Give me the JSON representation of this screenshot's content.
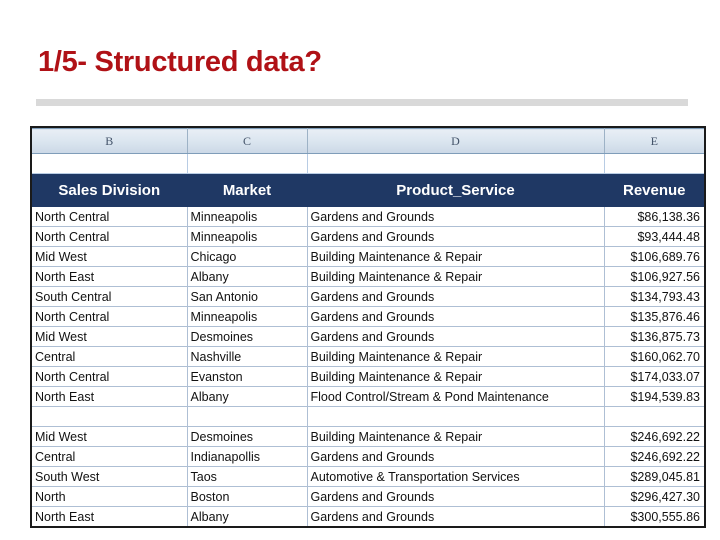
{
  "slide": {
    "title": "1/5- Structured data?",
    "title_color": "#B01116",
    "divider_color": "#D9D9D9"
  },
  "spreadsheet": {
    "header_bg": "#1F3864",
    "header_text_color": "#FFFFFF",
    "column_letters": [
      "B",
      "C",
      "D",
      "E"
    ],
    "columns": [
      "Sales Division",
      "Market",
      "Product_Service",
      "Revenue"
    ],
    "rows": [
      {
        "division": "North Central",
        "market": "Minneapolis",
        "product": "Gardens and Grounds",
        "revenue": "$86,138.36"
      },
      {
        "division": "North Central",
        "market": "Minneapolis",
        "product": "Gardens and Grounds",
        "revenue": "$93,444.48"
      },
      {
        "division": "Mid West",
        "market": "Chicago",
        "product": "Building Maintenance & Repair",
        "revenue": "$106,689.76"
      },
      {
        "division": "North East",
        "market": "Albany",
        "product": "Building Maintenance & Repair",
        "revenue": "$106,927.56"
      },
      {
        "division": "South Central",
        "market": "San Antonio",
        "product": "Gardens and Grounds",
        "revenue": "$134,793.43"
      },
      {
        "division": "North Central",
        "market": "Minneapolis",
        "product": "Gardens and Grounds",
        "revenue": "$135,876.46"
      },
      {
        "division": "Mid West",
        "market": "Desmoines",
        "product": "Gardens and Grounds",
        "revenue": "$136,875.73"
      },
      {
        "division": "Central",
        "market": "Nashville",
        "product": "Building Maintenance & Repair",
        "revenue": "$160,062.70"
      },
      {
        "division": "North Central",
        "market": "Evanston",
        "product": "Building Maintenance & Repair",
        "revenue": "$174,033.07"
      },
      {
        "division": "North East",
        "market": "Albany",
        "product": "Flood Control/Stream & Pond Maintenance",
        "revenue": "$194,539.83"
      },
      {
        "division": "",
        "market": "",
        "product": "",
        "revenue": ""
      },
      {
        "division": "Mid West",
        "market": "Desmoines",
        "product": "Building Maintenance & Repair",
        "revenue": "$246,692.22"
      },
      {
        "division": "Central",
        "market": "Indianapollis",
        "product": "Gardens and Grounds",
        "revenue": "$246,692.22"
      },
      {
        "division": "South West",
        "market": "Taos",
        "product": "Automotive & Transportation Services",
        "revenue": "$289,045.81"
      },
      {
        "division": "North",
        "market": "Boston",
        "product": "Gardens and Grounds",
        "revenue": "$296,427.30"
      },
      {
        "division": "North East",
        "market": "Albany",
        "product": "Gardens and Grounds",
        "revenue": "$300,555.86"
      }
    ]
  }
}
